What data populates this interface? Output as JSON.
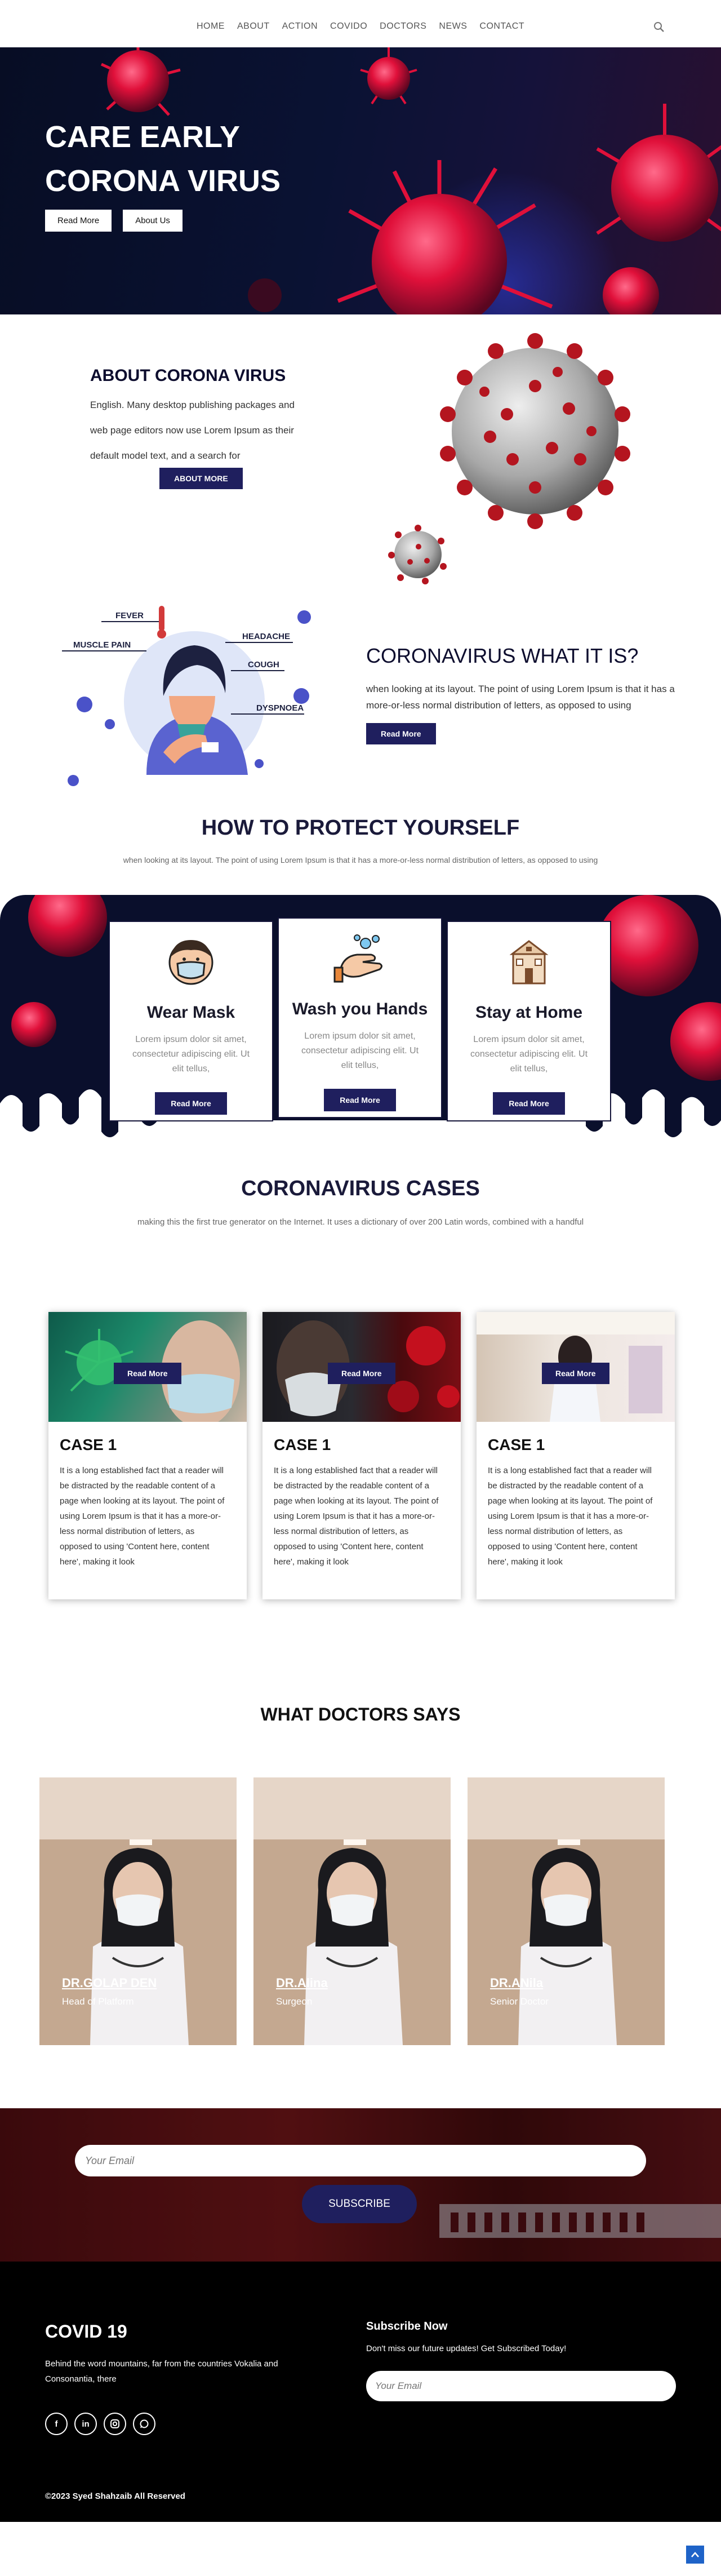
{
  "nav": {
    "items": [
      "HOME",
      "ABOUT",
      "ACTION",
      "COVIDO",
      "DOCTORS",
      "NEWS",
      "CONTACT"
    ],
    "search_icon": "search-icon"
  },
  "hero": {
    "title_line1": "CARE EARLY",
    "title_line2": "CORONA VIRUS",
    "btn_read_more": "Read More",
    "btn_about_us": "About Us"
  },
  "about": {
    "title": "ABOUT CORONA VIRUS",
    "text": "English. Many desktop publishing packages and web page editors now use Lorem Ipsum as their default model text, and a search for",
    "button": "ABOUT MORE"
  },
  "what": {
    "title": "CORONAVIRUS WHAT IT IS?",
    "text": "when looking at its layout. The point of using Lorem Ipsum is that it has a more-or-less normal distribution of letters, as opposed to using",
    "button": "Read More",
    "symptoms": [
      "FEVER",
      "MUSCLE PAIN",
      "HEADACHE",
      "COUGH",
      "DYSPNOEA"
    ]
  },
  "protect": {
    "title": "HOW TO PROTECT YOURSELF",
    "subtitle": "when looking at its layout. The point of using Lorem Ipsum is that it has a more-or-less normal distribution of letters, as opposed to using",
    "cards": [
      {
        "title": "Wear Mask",
        "text": "Lorem ipsum dolor sit amet, consectetur adipiscing elit. Ut elit tellus,",
        "button": "Read More",
        "icon": "mask-icon"
      },
      {
        "title": "Wash you Hands",
        "text": "Lorem ipsum dolor sit amet, consectetur adipiscing elit. Ut elit tellus,",
        "button": "Read More",
        "icon": "hand-wash-icon"
      },
      {
        "title": "Stay at Home",
        "text": "Lorem ipsum dolor sit amet, consectetur adipiscing elit. Ut elit tellus,",
        "button": "Read More",
        "icon": "home-icon"
      }
    ]
  },
  "cases": {
    "title": "CORONAVIRUS CASES",
    "subtitle": "making this the first true generator on the Internet. It uses a dictionary of over 200 Latin words, combined with a handful",
    "items": [
      {
        "title": "CASE 1",
        "button": "Read More",
        "text": "It is a long established fact that a reader will be distracted by the readable content of a page when looking at its layout. The point of using Lorem Ipsum is that it has a more-or-less normal distribution of letters, as opposed to using 'Content here, content here', making it look"
      },
      {
        "title": "CASE 1",
        "button": "Read More",
        "text": "It is a long established fact that a reader will be distracted by the readable content of a page when looking at its layout. The point of using Lorem Ipsum is that it has a more-or-less normal distribution of letters, as opposed to using 'Content here, content here', making it look"
      },
      {
        "title": "CASE 1",
        "button": "Read More",
        "text": "It is a long established fact that a reader will be distracted by the readable content of a page when looking at its layout. The point of using Lorem Ipsum is that it has a more-or-less normal distribution of letters, as opposed to using 'Content here, content here', making it look"
      }
    ]
  },
  "doctors": {
    "title": "WHAT DOCTORS SAYS",
    "items": [
      {
        "name": "DR.GOLAP DEN",
        "role": "Head of Platform"
      },
      {
        "name": "DR.Alina",
        "role": "Surgeon"
      },
      {
        "name": "DR.ANila",
        "role": "Senior Doctor"
      }
    ]
  },
  "subscribe": {
    "placeholder": "Your Email",
    "button": "SUBSCRIBE"
  },
  "footer": {
    "title": "COVID 19",
    "text": "Behind the word mountains, far from the countries Vokalia and Consonantia, there",
    "social": [
      "f",
      "in",
      "ig",
      "wa"
    ],
    "subscribe_title": "Subscribe Now",
    "subscribe_text": "Don't miss our future updates! Get Subscribed Today!",
    "subscribe_placeholder": "Your Email",
    "copyright": "©2023 Syed Shahzaib All Reserved"
  },
  "colors": {
    "navy": "#1f1f5e",
    "dark_bg": "#0a0f2c",
    "virus_red": "#e0103a",
    "accent_blue": "#1e63c8"
  }
}
